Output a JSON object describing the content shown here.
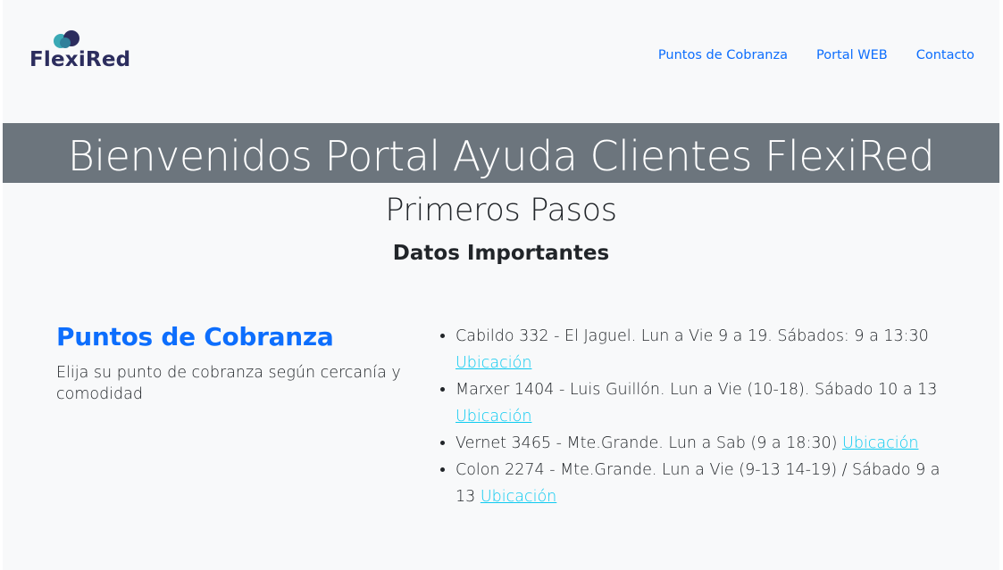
{
  "header": {
    "logo_text": "FlexiRed",
    "nav": [
      "Puntos de Cobranza",
      "Portal WEB",
      "Contacto"
    ]
  },
  "banner": {
    "title": "Bienvenidos Portal Ayuda Clientes FlexiRed"
  },
  "main": {
    "subtitle": "Primeros Pasos",
    "heading": "Datos Importantes"
  },
  "section": {
    "title": "Puntos de Cobranza",
    "description": "Elija su punto de cobranza según cercanía y comodidad",
    "locations": [
      {
        "text": "Cabildo 332 - El Jaguel. Lun a Vie 9 a 19. Sábados: 9 a 13:30",
        "link": "Ubicación"
      },
      {
        "text": "Marxer 1404 - Luis Guillón. Lun a Vie (10-18). Sábado 10 a 13",
        "link": "Ubicación"
      },
      {
        "text": "Vernet 3465 - Mte.Grande. Lun a Sab (9 a 18:30)",
        "link": "Ubicación"
      },
      {
        "text": "Colon 2274 - Mte.Grande. Lun a Vie (9-13 14-19) / Sábado 9 a 13",
        "link": "Ubicación"
      }
    ]
  },
  "colors": {
    "primary": "#0d6efd",
    "link_info": "#0dcaf0",
    "banner_bg": "#6c757d",
    "page_bg": "#f8f9fa",
    "logo_navy": "#2c2d5e",
    "logo_teal": "#3aa9b5"
  }
}
